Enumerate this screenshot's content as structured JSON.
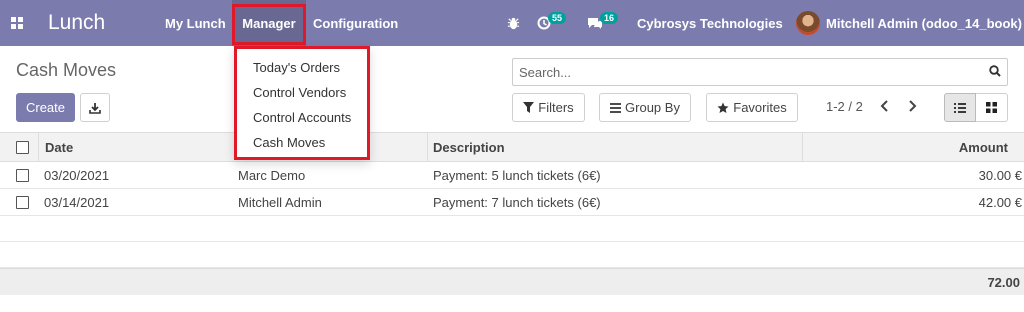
{
  "navbar": {
    "brand": "Lunch",
    "menus": [
      "My Lunch",
      "Manager",
      "Configuration"
    ],
    "activity_count": "55",
    "message_count": "16",
    "company": "Cybrosys Technologies",
    "user": "Mitchell Admin (odoo_14_book)",
    "color": "#7c7bad"
  },
  "manager_dropdown": {
    "items": [
      "Today's Orders",
      "Control Vendors",
      "Control Accounts",
      "Cash Moves"
    ]
  },
  "control_panel": {
    "title": "Cash Moves",
    "search_placeholder": "Search...",
    "create_label": "Create",
    "filters_label": "Filters",
    "groupby_label": "Group By",
    "favorites_label": "Favorites",
    "pager": "1-2 / 2"
  },
  "table": {
    "headers": {
      "date": "Date",
      "description": "Description",
      "amount": "Amount"
    },
    "rows": [
      {
        "date": "03/20/2021",
        "user": "Marc Demo",
        "description": "Payment: 5 lunch tickets (6€)",
        "amount": "30.00 €"
      },
      {
        "date": "03/14/2021",
        "user": "Mitchell Admin",
        "description": "Payment: 7 lunch tickets (6€)",
        "amount": "42.00 €"
      }
    ],
    "total": "72.00"
  },
  "icons": [
    "apps-icon",
    "bug-icon",
    "activity-icon",
    "chat-icon",
    "avatar",
    "download-icon",
    "search-icon",
    "filter-icon",
    "groupby-icon",
    "star-icon",
    "chevron-left-icon",
    "chevron-right-icon",
    "list-view-icon",
    "kanban-view-icon"
  ]
}
